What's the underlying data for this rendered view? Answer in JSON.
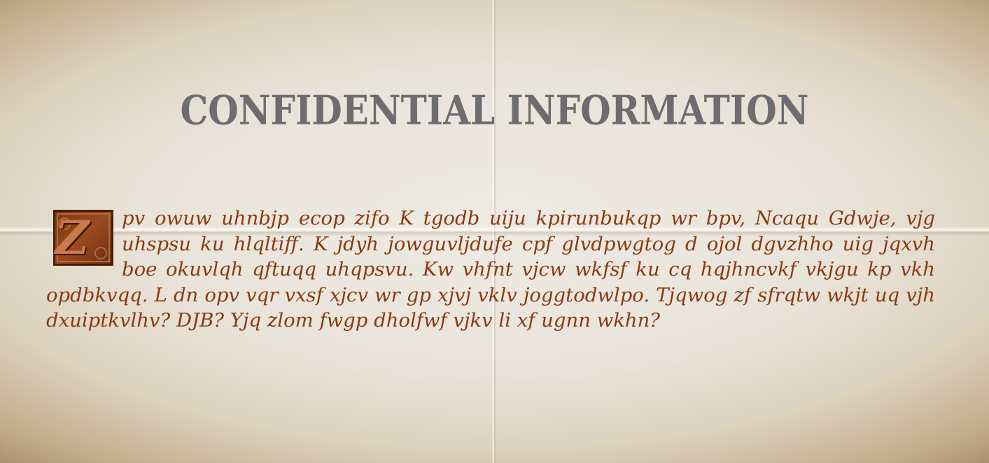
{
  "document": {
    "title": "CONFIDENTIAL INFORMATION",
    "drop_cap": "Z",
    "body": "pv owuw uhnbjp ecop zifo K tgodb uiju kpirunbukqp wr bpv, Ncaqu Gdwje, vjg uhspsu ku hlqltiff. K jdyh jowguvljdufe cpf glvdpwgtog d ojol dgvzhho uig jqxvh boe okuvlqh qftuqq uhqpsvu. Kw vhfnt vjcw wkfsf ku cq hqjhncvkf vkjgu kp vkh opdbkvqq. L dn opv vqr vxsf xjcv wr gp xjvj vklv joggtodwlpo. Tjqwog zf sfrqtw wkjt uq vjh dxuiptkvlhv? DJB? Yjq zlom fwgp dholfwf vjkv li xf ugnn wkhn?"
  },
  "colors": {
    "title": "#6d6d70",
    "body_text": "#8a3a10",
    "parchment_light": "#eeebe4",
    "parchment_edge": "#a88a66",
    "drop_cap_fill": "#9b4a1f"
  }
}
